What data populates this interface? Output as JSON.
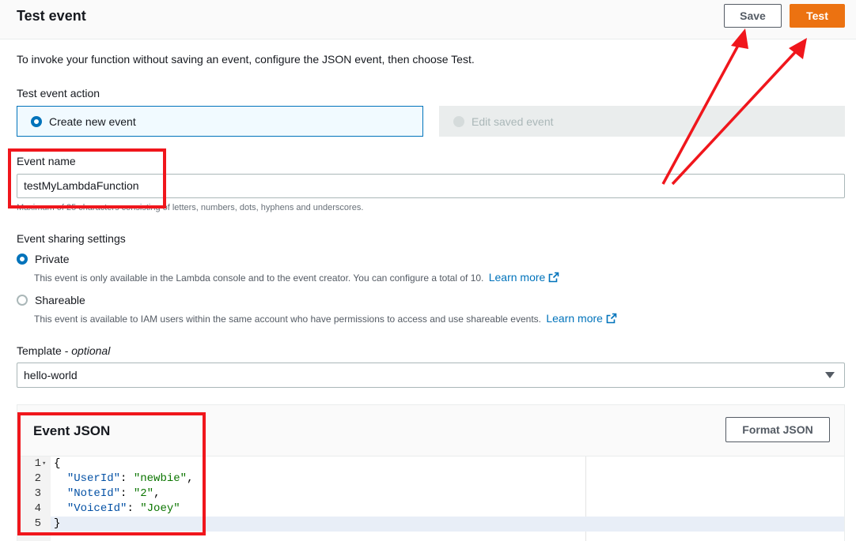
{
  "header": {
    "title": "Test event",
    "save_label": "Save",
    "test_label": "Test"
  },
  "intro": "To invoke your function without saving an event, configure the JSON event, then choose Test.",
  "test_event_action": {
    "label": "Test event action",
    "options": [
      {
        "label": "Create new event",
        "selected": true
      },
      {
        "label": "Edit saved event",
        "selected": false,
        "disabled": true
      }
    ]
  },
  "event_name": {
    "label": "Event name",
    "value": "testMyLambdaFunction",
    "hint": "Maximum of 25 characters consisting of letters, numbers, dots, hyphens and underscores."
  },
  "sharing": {
    "label": "Event sharing settings",
    "options": [
      {
        "label": "Private",
        "selected": true,
        "description": "This event is only available in the Lambda console and to the event creator. You can configure a total of 10.",
        "link": "Learn more"
      },
      {
        "label": "Shareable",
        "selected": false,
        "description": "This event is available to IAM users within the same account who have permissions to access and use shareable events.",
        "link": "Learn more"
      }
    ]
  },
  "template": {
    "label": "Template",
    "optional": "optional",
    "selected": "hello-world"
  },
  "event_json": {
    "title": "Event JSON",
    "format_label": "Format JSON",
    "lines": [
      {
        "num": "1",
        "text": "{"
      },
      {
        "num": "2",
        "key": "\"UserId\"",
        "value": "\"newbie\"",
        "trail": ","
      },
      {
        "num": "3",
        "key": "\"NoteId\"",
        "value": "\"2\"",
        "trail": ","
      },
      {
        "num": "4",
        "key": "\"VoiceId\"",
        "value": "\"Joey\"",
        "trail": ""
      },
      {
        "num": "5",
        "text": "}"
      }
    ]
  },
  "colors": {
    "accent": "#0073bb",
    "primary_button": "#ec7211",
    "annotation": "#f0161c"
  },
  "icons": [
    "external-link-icon",
    "caret-down-icon",
    "fold-arrow-icon",
    "annotation-arrow-icon"
  ]
}
